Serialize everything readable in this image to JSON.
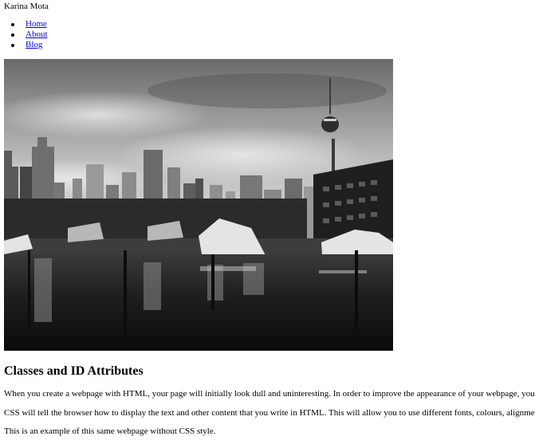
{
  "site": {
    "name": "Karina Mota"
  },
  "nav": {
    "items": [
      {
        "label": "Home"
      },
      {
        "label": "About"
      },
      {
        "label": "Blog"
      }
    ]
  },
  "hero": {
    "kind": "black-and-white photo of a city harbour skyline with a tall tower, high-rise buildings and moored boats reflected in water"
  },
  "article": {
    "heading": "Classes and ID Attributes",
    "paragraphs": [
      "When you create a webpage with HTML, your page will initially look dull and uninteresting. In order to improve the appearance of your webpage, you will",
      "CSS will tell the browser how to display the text and other content that you write in HTML. This will allow you to use different fonts, colours, alignments, b",
      "This is an example of this same webpage without CSS style."
    ]
  },
  "colors": {
    "link": "#0000ee",
    "text": "#000000",
    "background": "#ffffff"
  }
}
